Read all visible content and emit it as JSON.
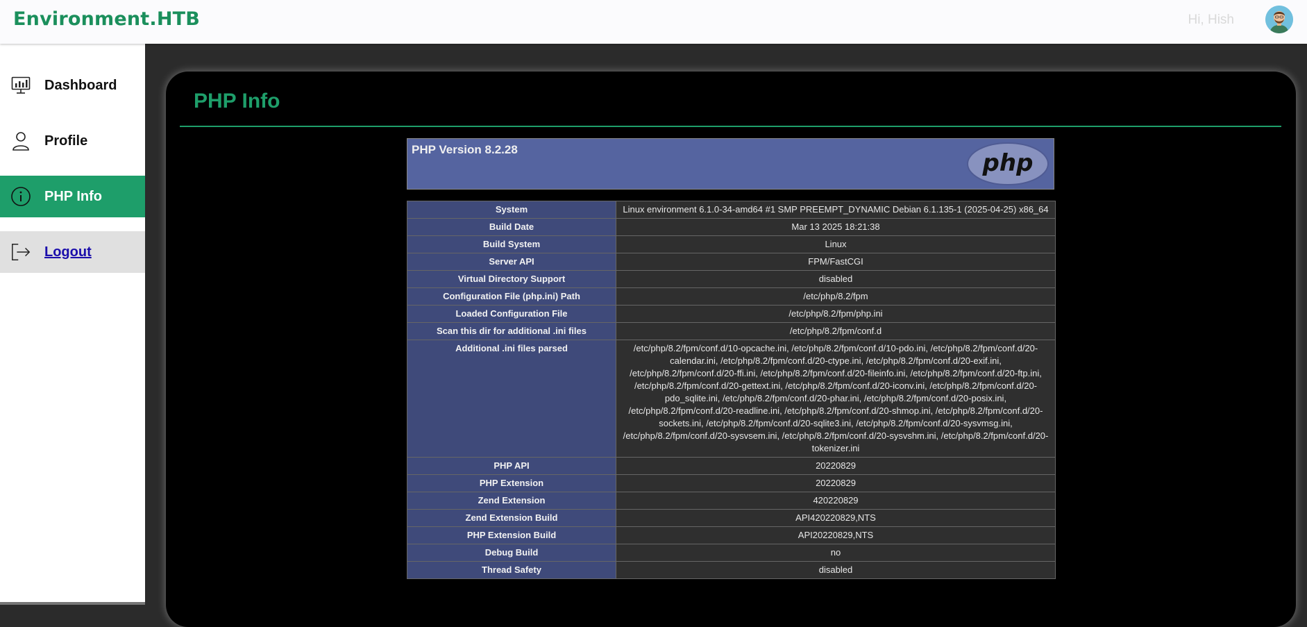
{
  "header": {
    "brand": "Environment.HTB",
    "greeting": "Hi, Hish",
    "avatar_icon": "user-avatar"
  },
  "sidebar": {
    "items": [
      {
        "label": "Dashboard",
        "icon": "dashboard-icon"
      },
      {
        "label": "Profile",
        "icon": "user-icon"
      },
      {
        "label": "PHP Info",
        "icon": "info-icon"
      },
      {
        "label": "Logout",
        "icon": "logout-icon"
      }
    ]
  },
  "main": {
    "title": "PHP Info",
    "php_version": "PHP Version 8.2.28",
    "logo_text": "php",
    "rows": [
      {
        "k": "System",
        "v": "Linux environment 6.1.0-34-amd64 #1 SMP PREEMPT_DYNAMIC Debian 6.1.135-1 (2025-04-25) x86_64"
      },
      {
        "k": "Build Date",
        "v": "Mar 13 2025 18:21:38"
      },
      {
        "k": "Build System",
        "v": "Linux"
      },
      {
        "k": "Server API",
        "v": "FPM/FastCGI"
      },
      {
        "k": "Virtual Directory Support",
        "v": "disabled"
      },
      {
        "k": "Configuration File (php.ini) Path",
        "v": "/etc/php/8.2/fpm"
      },
      {
        "k": "Loaded Configuration File",
        "v": "/etc/php/8.2/fpm/php.ini"
      },
      {
        "k": "Scan this dir for additional .ini files",
        "v": "/etc/php/8.2/fpm/conf.d"
      },
      {
        "k": "Additional .ini files parsed",
        "v": "/etc/php/8.2/fpm/conf.d/10-opcache.ini, /etc/php/8.2/fpm/conf.d/10-pdo.ini, /etc/php/8.2/fpm/conf.d/20-calendar.ini, /etc/php/8.2/fpm/conf.d/20-ctype.ini, /etc/php/8.2/fpm/conf.d/20-exif.ini, /etc/php/8.2/fpm/conf.d/20-ffi.ini, /etc/php/8.2/fpm/conf.d/20-fileinfo.ini, /etc/php/8.2/fpm/conf.d/20-ftp.ini, /etc/php/8.2/fpm/conf.d/20-gettext.ini, /etc/php/8.2/fpm/conf.d/20-iconv.ini, /etc/php/8.2/fpm/conf.d/20-pdo_sqlite.ini, /etc/php/8.2/fpm/conf.d/20-phar.ini, /etc/php/8.2/fpm/conf.d/20-posix.ini, /etc/php/8.2/fpm/conf.d/20-readline.ini, /etc/php/8.2/fpm/conf.d/20-shmop.ini, /etc/php/8.2/fpm/conf.d/20-sockets.ini, /etc/php/8.2/fpm/conf.d/20-sqlite3.ini, /etc/php/8.2/fpm/conf.d/20-sysvmsg.ini, /etc/php/8.2/fpm/conf.d/20-sysvsem.ini, /etc/php/8.2/fpm/conf.d/20-sysvshm.ini, /etc/php/8.2/fpm/conf.d/20-tokenizer.ini"
      },
      {
        "k": "PHP API",
        "v": "20220829"
      },
      {
        "k": "PHP Extension",
        "v": "20220829"
      },
      {
        "k": "Zend Extension",
        "v": "420220829"
      },
      {
        "k": "Zend Extension Build",
        "v": "API420220829,NTS"
      },
      {
        "k": "PHP Extension Build",
        "v": "API20220829,NTS"
      },
      {
        "k": "Debug Build",
        "v": "no"
      },
      {
        "k": "Thread Safety",
        "v": "disabled"
      }
    ]
  },
  "colors": {
    "accent": "#1e9e6a",
    "table_key_bg": "#3f4a7a",
    "table_val_bg": "#2f2f2f",
    "php_header_bg": "#5564a0"
  }
}
